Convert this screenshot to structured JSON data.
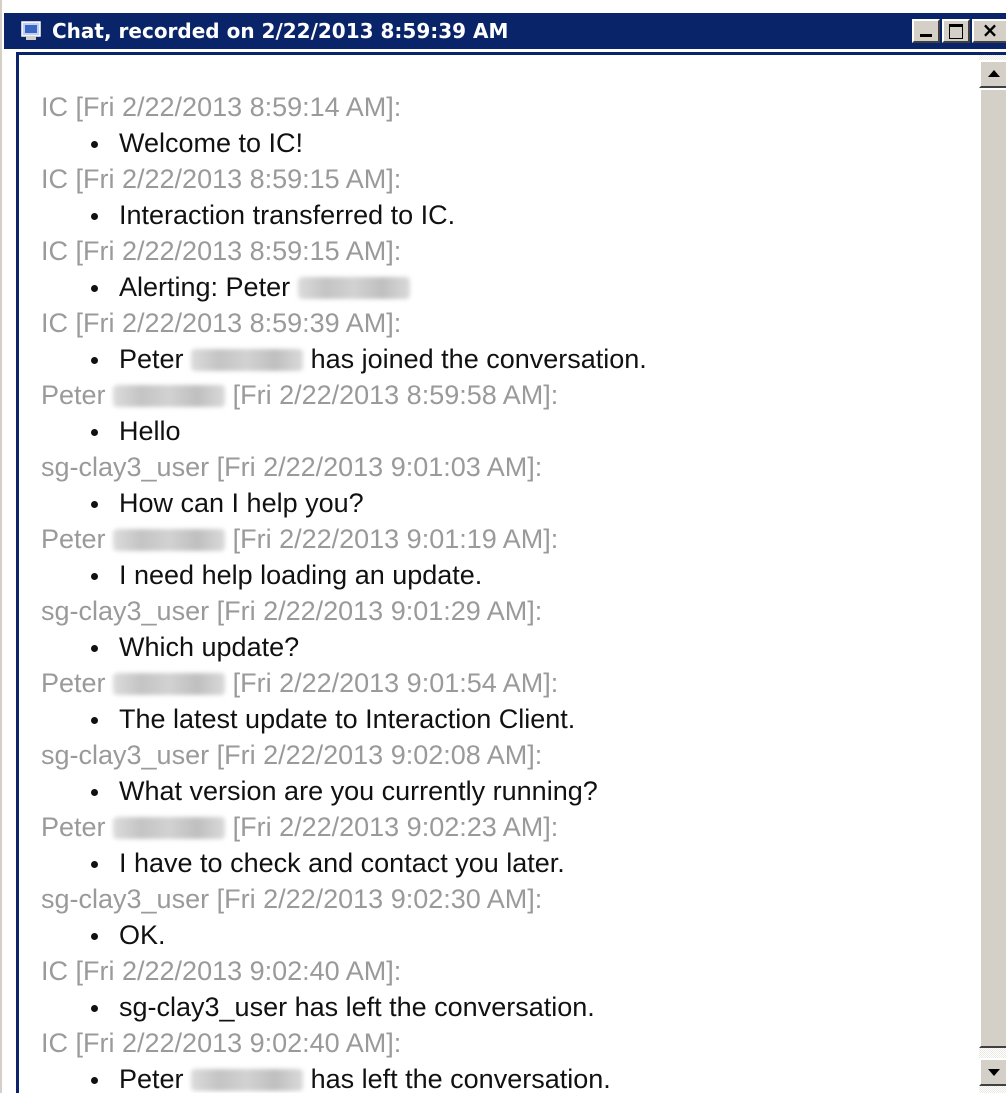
{
  "window": {
    "title": "Chat,  recorded on 2/22/2013 8:59:39 AM",
    "icon": "chat-window-icon",
    "controls": {
      "minimize": "minimize-icon",
      "maximize": "maximize-icon",
      "close": "×"
    },
    "title_bar_color": "#0a246a"
  },
  "transcript": {
    "header_color": "#9a9a9a",
    "body_color": "#111111",
    "messages": [
      {
        "sender": "IC",
        "sender_redacted": false,
        "timestamp": "[Fri 2/22/2013 8:59:14 AM]:",
        "text_before": "Welcome to IC!",
        "text_redacted": false,
        "text_after": ""
      },
      {
        "sender": "IC",
        "sender_redacted": false,
        "timestamp": "[Fri 2/22/2013 8:59:15 AM]:",
        "text_before": "Interaction transferred to IC.",
        "text_redacted": false,
        "text_after": ""
      },
      {
        "sender": "IC",
        "sender_redacted": false,
        "timestamp": "[Fri 2/22/2013 8:59:15 AM]:",
        "text_before": "Alerting: Peter",
        "text_redacted": true,
        "text_after": ""
      },
      {
        "sender": "IC",
        "sender_redacted": false,
        "timestamp": "[Fri 2/22/2013 8:59:39 AM]:",
        "text_before": "Peter",
        "text_redacted": true,
        "text_after": "has joined the conversation."
      },
      {
        "sender": "Peter",
        "sender_redacted": true,
        "timestamp": "[Fri 2/22/2013 8:59:58 AM]:",
        "text_before": "Hello",
        "text_redacted": false,
        "text_after": ""
      },
      {
        "sender": "sg-clay3_user",
        "sender_redacted": false,
        "timestamp": "[Fri 2/22/2013 9:01:03 AM]:",
        "text_before": "How can I help you?",
        "text_redacted": false,
        "text_after": ""
      },
      {
        "sender": "Peter",
        "sender_redacted": true,
        "timestamp": "[Fri 2/22/2013 9:01:19 AM]:",
        "text_before": "I need help loading an update.",
        "text_redacted": false,
        "text_after": ""
      },
      {
        "sender": "sg-clay3_user",
        "sender_redacted": false,
        "timestamp": "[Fri 2/22/2013 9:01:29 AM]:",
        "text_before": "Which update?",
        "text_redacted": false,
        "text_after": ""
      },
      {
        "sender": "Peter",
        "sender_redacted": true,
        "timestamp": "[Fri 2/22/2013 9:01:54 AM]:",
        "text_before": "The latest update to Interaction Client.",
        "text_redacted": false,
        "text_after": ""
      },
      {
        "sender": "sg-clay3_user",
        "sender_redacted": false,
        "timestamp": "[Fri 2/22/2013 9:02:08 AM]:",
        "text_before": "What version are you currently running?",
        "text_redacted": false,
        "text_after": ""
      },
      {
        "sender": "Peter",
        "sender_redacted": true,
        "timestamp": "[Fri 2/22/2013 9:02:23 AM]:",
        "text_before": "I have to check and contact you later.",
        "text_redacted": false,
        "text_after": ""
      },
      {
        "sender": "sg-clay3_user",
        "sender_redacted": false,
        "timestamp": "[Fri 2/22/2013 9:02:30 AM]:",
        "text_before": "OK.",
        "text_redacted": false,
        "text_after": ""
      },
      {
        "sender": "IC",
        "sender_redacted": false,
        "timestamp": "[Fri 2/22/2013 9:02:40 AM]:",
        "text_before": "sg-clay3_user has left the conversation.",
        "text_redacted": false,
        "text_after": ""
      },
      {
        "sender": "IC",
        "sender_redacted": false,
        "timestamp": "[Fri 2/22/2013 9:02:40 AM]:",
        "text_before": "Peter",
        "text_redacted": true,
        "text_after": "has left the conversation."
      }
    ]
  },
  "scrollbar": {
    "up_icon": "scroll-up-arrow-icon",
    "down_icon": "scroll-down-arrow-icon"
  }
}
